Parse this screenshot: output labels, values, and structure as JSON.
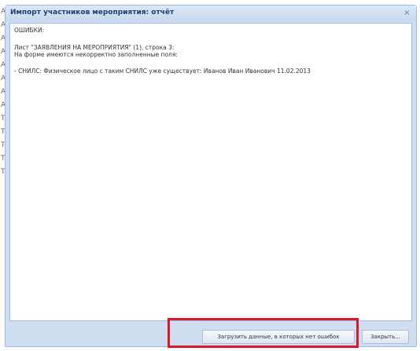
{
  "dialog": {
    "title": "Импорт участников мероприятия: отчёт",
    "close_glyph": "×",
    "report_lines": [
      "ОШИБКИ:",
      "Лист \"ЗАЯВЛЕНИЯ НА МЕРОПРИЯТИЯ\" (1), строка 3:",
      "На форме имеются некорректно заполненные поля:",
      "- СНИЛС: Физическое лицо с таким СНИЛС уже существует: Иванов Иван Иванович 11.02.2013"
    ],
    "load_button": "Загрузить данные, в которых нет ошибок",
    "close_button": "Закрыть..."
  },
  "background": {
    "letters": [
      "А",
      "А",
      "А",
      "А",
      "А",
      "А",
      "А",
      "А",
      "Т",
      "Т",
      "Т",
      "Т",
      "Т"
    ]
  },
  "colors": {
    "highlight": "#e0152a",
    "window_border": "#99bbe8",
    "title_text": "#1f3e6e"
  }
}
